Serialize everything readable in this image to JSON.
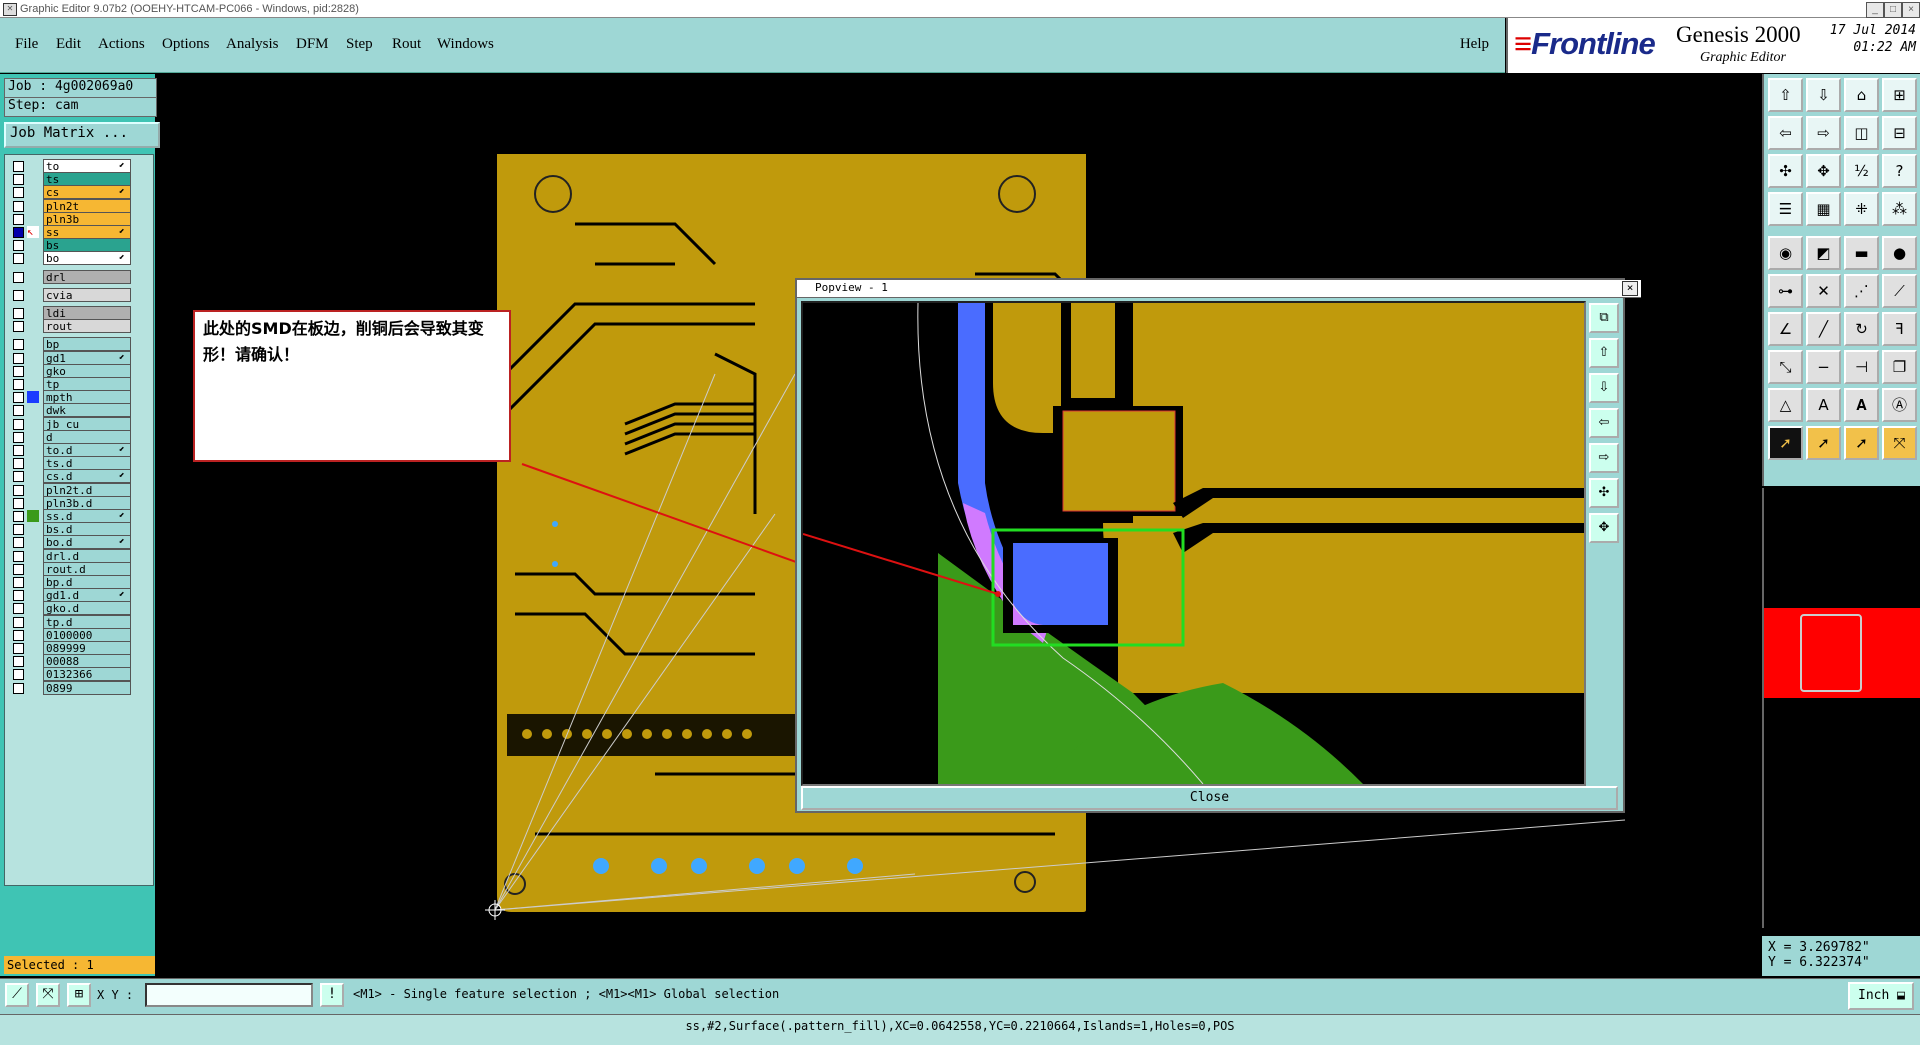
{
  "window": {
    "title": "Graphic Editor 9.07b2 (OOEHY-HTCAM-PC066 - Windows, pid:2828)",
    "controls": [
      "_",
      "□",
      "×"
    ]
  },
  "menu": {
    "items": [
      "File",
      "Edit",
      "Actions",
      "Options",
      "Analysis",
      "DFM",
      "Step",
      "Rout",
      "Windows"
    ],
    "help": "Help"
  },
  "brand": {
    "logo": "Frontline",
    "product": "Genesis 2000",
    "subtitle": "Graphic Editor",
    "date": "17 Jul 2014",
    "time": "01:22 AM"
  },
  "job": {
    "job_label": "Job : 4g002069a0",
    "step_label": "Step: cam",
    "matrix_button": "Job Matrix ..."
  },
  "layers": [
    {
      "name": "to",
      "color": "#ffffff",
      "mark": "⬋"
    },
    {
      "name": "ts",
      "color": "#2aa38f",
      "mark": ""
    },
    {
      "name": "cs",
      "color": "#f6b733",
      "mark": "⬋"
    },
    {
      "name": "pln2t",
      "color": "#f6b733",
      "mark": ""
    },
    {
      "name": "pln3b",
      "color": "#f6b733",
      "mark": ""
    },
    {
      "name": "ss",
      "color": "#f6b733",
      "mark": "⬋",
      "active": true
    },
    {
      "name": "bs",
      "color": "#2aa38f",
      "mark": ""
    },
    {
      "name": "bo",
      "color": "#ffffff",
      "mark": "⬋"
    },
    {
      "name": "drl",
      "color": "#b0b0b0",
      "mark": ""
    },
    {
      "name": "cvia",
      "color": "#d8d8d8",
      "mark": ""
    },
    {
      "name": "ldi",
      "color": "#b0b0b0",
      "mark": ""
    },
    {
      "name": "rout",
      "color": "#d8d8d8",
      "mark": ""
    },
    {
      "name": "bp",
      "color": "#9ed7d5",
      "mark": ""
    },
    {
      "name": "gd1",
      "color": "#9ed7d5",
      "mark": "⬋"
    },
    {
      "name": "gko",
      "color": "#9ed7d5",
      "mark": ""
    },
    {
      "name": "tp",
      "color": "#9ed7d5",
      "mark": ""
    },
    {
      "name": "mpth",
      "color": "#9ed7d5",
      "mark": "",
      "indicator": "#1a3cff"
    },
    {
      "name": "dwk",
      "color": "#9ed7d5",
      "mark": ""
    },
    {
      "name": "jb_cu",
      "color": "#9ed7d5",
      "mark": ""
    },
    {
      "name": "d",
      "color": "#9ed7d5",
      "mark": ""
    },
    {
      "name": "to.d",
      "color": "#9ed7d5",
      "mark": "⬋"
    },
    {
      "name": "ts.d",
      "color": "#9ed7d5",
      "mark": ""
    },
    {
      "name": "cs.d",
      "color": "#9ed7d5",
      "mark": "⬋"
    },
    {
      "name": "pln2t.d",
      "color": "#9ed7d5",
      "mark": ""
    },
    {
      "name": "pln3b.d",
      "color": "#9ed7d5",
      "mark": ""
    },
    {
      "name": "ss.d",
      "color": "#9ed7d5",
      "mark": "⬋",
      "indicator": "#3a9a1a"
    },
    {
      "name": "bs.d",
      "color": "#9ed7d5",
      "mark": ""
    },
    {
      "name": "bo.d",
      "color": "#9ed7d5",
      "mark": "⬋"
    },
    {
      "name": "drl.d",
      "color": "#9ed7d5",
      "mark": ""
    },
    {
      "name": "rout.d",
      "color": "#9ed7d5",
      "mark": ""
    },
    {
      "name": "bp.d",
      "color": "#9ed7d5",
      "mark": ""
    },
    {
      "name": "gd1.d",
      "color": "#9ed7d5",
      "mark": "⬋"
    },
    {
      "name": "gko.d",
      "color": "#9ed7d5",
      "mark": ""
    },
    {
      "name": "tp.d",
      "color": "#9ed7d5",
      "mark": ""
    },
    {
      "name": "0100000",
      "color": "#9ed7d5",
      "mark": ""
    },
    {
      "name": "089999",
      "color": "#9ed7d5",
      "mark": ""
    },
    {
      "name": "00088",
      "color": "#9ed7d5",
      "mark": ""
    },
    {
      "name": "0132366",
      "color": "#9ed7d5",
      "mark": ""
    },
    {
      "name": "0899",
      "color": "#9ed7d5",
      "mark": ""
    }
  ],
  "selected": "Selected : 1",
  "popview": {
    "title": "Popview - 1",
    "close_label": "Close"
  },
  "note": {
    "text": "此处的SMD在板边，削铜后会导致其变形！请确认！"
  },
  "coords": {
    "x": "X = 3.269782\"",
    "y": "Y = 6.322374\""
  },
  "bottom": {
    "xy_label": "X Y :",
    "xy_value": "",
    "hint": "<M1> - Single feature selection ; <M1><M1> Global selection",
    "units": "Inch"
  },
  "status": "ss,#2,Surface(.pattern_fill),XC=0.0642558,YC=0.2210664,Islands=1,Holes=0,POS",
  "colors": {
    "panel": "#9ed7d5",
    "panel_dark": "#3fc4b4",
    "board_copper": "#c09a0c",
    "feature_blue": "#4a6cff",
    "feature_magenta": "#d07aff",
    "feature_green": "#3a9a1a",
    "highlight": "#22dd22",
    "arrow": "#dd1111"
  }
}
